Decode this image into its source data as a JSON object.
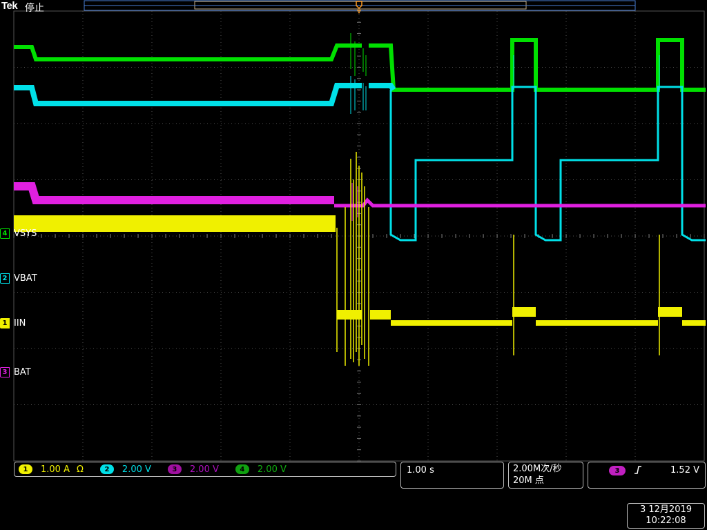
{
  "header": {
    "brand": "Tek",
    "run_state": "停止"
  },
  "channels": [
    {
      "num": "4",
      "label": "VSYS",
      "color": "#00e000"
    },
    {
      "num": "2",
      "label": "VBAT",
      "color": "#00e0e8"
    },
    {
      "num": "1",
      "label": "IIN",
      "color": "#f0f000"
    },
    {
      "num": "3",
      "label": "BAT",
      "color": "#e020e0"
    }
  ],
  "scales": [
    {
      "num": "1",
      "value": "1.00 A",
      "extra": "Ω",
      "color": "#f0f000"
    },
    {
      "num": "2",
      "value": "2.00 V",
      "extra": "",
      "color": "#00e0e8"
    },
    {
      "num": "3",
      "value": "2.00 V",
      "extra": "",
      "color": "#e020e0"
    },
    {
      "num": "4",
      "value": "2.00 V",
      "extra": "",
      "color": "#00e000"
    }
  ],
  "timebase": "1.00 s",
  "acquisition": {
    "rate": "2.00M次/秒",
    "points": "20M 点"
  },
  "trigger": {
    "source": "3",
    "slope_icon": "rising-edge-icon",
    "level": "1.52 V",
    "color": "#e020e0"
  },
  "datetime": {
    "date": "3 12月2019",
    "time": "10:22:08"
  }
}
